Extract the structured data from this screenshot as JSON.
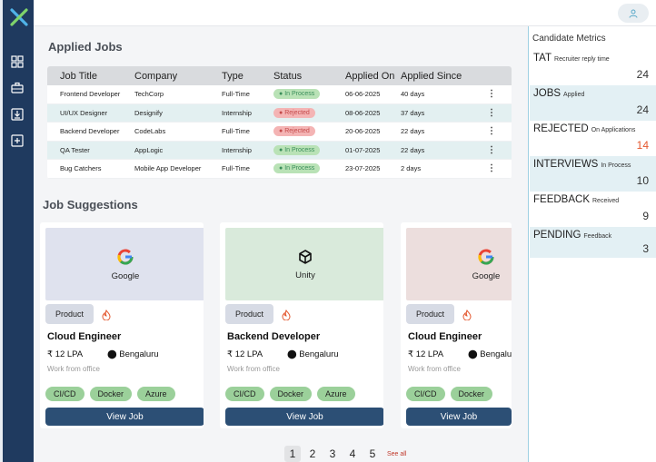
{
  "applied": {
    "heading": "Applied Jobs",
    "columns": [
      "Job Title",
      "Company",
      "Type",
      "Status",
      "Applied On",
      "Applied Since"
    ],
    "rows": [
      {
        "title": "Frontend Developer",
        "company": "TechCorp",
        "type": "Full-Time",
        "status": "In Process",
        "applied_on": "06-06-2025",
        "since": "40 days"
      },
      {
        "title": "UI/UX Designer",
        "company": "Designify",
        "type": "Internship",
        "status": "Rejected",
        "applied_on": "08-06-2025",
        "since": "37 days"
      },
      {
        "title": "Backend Developer",
        "company": "CodeLabs",
        "type": "Full-Time",
        "status": "Rejected",
        "applied_on": "20-06-2025",
        "since": "22 days"
      },
      {
        "title": "QA Tester",
        "company": "AppLogic",
        "type": "Internship",
        "status": "In Process",
        "applied_on": "01-07-2025",
        "since": "22 days"
      },
      {
        "title": "Bug Catchers",
        "company": "Mobile App Developer",
        "type": "Full-Time",
        "status": "In Process",
        "applied_on": "23-07-2025",
        "since": "2 days"
      }
    ]
  },
  "suggestions": {
    "heading": "Job Suggestions",
    "cards": [
      {
        "brand": "Google",
        "category": "Product",
        "title": "Cloud  Engineer",
        "salary": "12 LPA",
        "location": "Bengaluru",
        "mode": "Work from office",
        "tags": [
          "CI/CD",
          "Docker",
          "Azure"
        ],
        "button": "View Job"
      },
      {
        "brand": "Unity",
        "category": "Product",
        "title": "Backend Developer",
        "salary": "12 LPA",
        "location": "Bengaluru",
        "mode": "Work from office",
        "tags": [
          "CI/CD",
          "Docker",
          "Azure"
        ],
        "button": "View Job"
      },
      {
        "brand": "Google",
        "category": "Product",
        "title": "Cloud  Engineer",
        "salary": "12 LPA",
        "location": "Bengaluru",
        "mode": "Work from office",
        "tags": [
          "CI/CD",
          "Docker"
        ],
        "button": "View Job"
      }
    ]
  },
  "pagination": {
    "pages": [
      "1",
      "2",
      "3",
      "4",
      "5"
    ],
    "active": "1",
    "see_all": "See all"
  },
  "metrics": {
    "title": "Candidate Metrics",
    "items": [
      {
        "label": "TAT",
        "sub": "Recruiter reply time",
        "value": "24",
        "highlight": false
      },
      {
        "label": "JOBS",
        "sub": "Applied",
        "value": "24",
        "highlight": false
      },
      {
        "label": "REJECTED",
        "sub": "On Applications",
        "value": "14",
        "highlight": true
      },
      {
        "label": "INTERVIEWS",
        "sub": "In Process",
        "value": "10",
        "highlight": false
      },
      {
        "label": "FEEDBACK",
        "sub": "Received",
        "value": "9",
        "highlight": false
      },
      {
        "label": "PENDING",
        "sub": "Feedback",
        "value": "3",
        "highlight": false
      }
    ]
  },
  "colors": {
    "sidebar": "#1f3a5f",
    "accent": "#2c4f75",
    "in_process": "#b9e2b6",
    "rejected": "#f4b4b4",
    "highlight_value": "#e4572e"
  },
  "icons": {
    "logo": "x-logo-icon",
    "nav": [
      "dashboard-icon",
      "briefcase-icon",
      "download-icon",
      "add-box-icon"
    ],
    "user": "user-icon"
  }
}
